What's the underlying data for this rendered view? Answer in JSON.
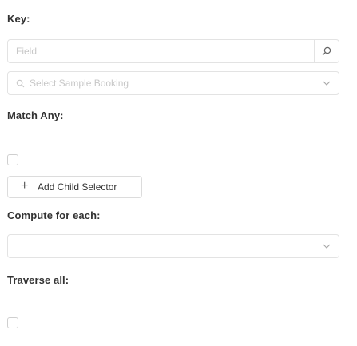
{
  "key_section": {
    "label": "Key:",
    "field_placeholder": "Field",
    "sample_select_placeholder": "Select Sample Booking"
  },
  "match_any": {
    "label": "Match Any:",
    "checked": false
  },
  "add_child_selector": {
    "plus": "+",
    "label": "Add Child Selector"
  },
  "compute_for_each": {
    "label": "Compute for each:",
    "value": ""
  },
  "traverse_all": {
    "label": "Traverse all:",
    "checked": false
  },
  "icons": {
    "field_search": "search-icon",
    "select_search": "search-icon",
    "chevron": "chevron-down-icon"
  },
  "colors": {
    "border": "#e3e3e3",
    "placeholder": "#c8c8c8",
    "label_text": "#333333"
  }
}
